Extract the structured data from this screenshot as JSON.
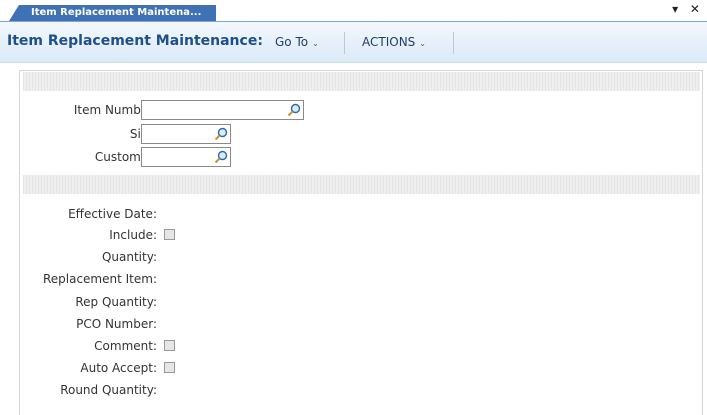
{
  "tab": {
    "label": "Item Replacement Maintena...",
    "controls": "▾ ✕"
  },
  "titlebar": {
    "title": "Item Replacement Maintenance:",
    "goto_label": "Go To",
    "actions_label": "ACTIONS"
  },
  "search_fields": [
    {
      "label": "Item Number:",
      "value": ""
    },
    {
      "label": "Site:",
      "value": ""
    },
    {
      "label": "Customer:",
      "value": ""
    }
  ],
  "details": [
    {
      "label": "Effective Date:"
    },
    {
      "label": "Include:",
      "checkbox": true
    },
    {
      "label": "Quantity:"
    },
    {
      "label": "Replacement Item:"
    },
    {
      "label": "Rep Quantity:"
    },
    {
      "label": "PCO Number:"
    },
    {
      "label": "Comment:",
      "checkbox": true
    },
    {
      "label": "Auto Accept:",
      "checkbox": true
    },
    {
      "label": "Round Quantity:"
    }
  ],
  "colors": {
    "tab": "#3f72b5",
    "title": "#1f4f89"
  },
  "icons": {
    "lookup": "magnifier-icon"
  }
}
